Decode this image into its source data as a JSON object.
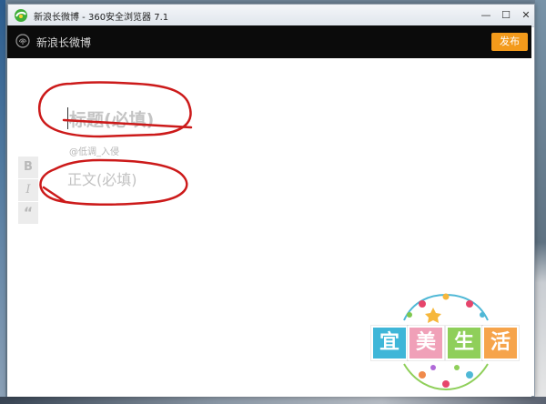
{
  "window": {
    "title": "新浪长微博 - 360安全浏览器 7.1",
    "controls": {
      "minimize": "—",
      "maximize": "☐",
      "close": "✕"
    }
  },
  "app": {
    "title": "新浪长微博",
    "publish_label": "发布"
  },
  "editor": {
    "title_placeholder": "标题(必填)",
    "author": "@低调_入侵",
    "body_placeholder": "正文(必填)"
  },
  "toolbar": {
    "bold_label": "B",
    "italic_label": "I",
    "quote_label": "“"
  },
  "sticker": {
    "chars": [
      "宜",
      "美",
      "生",
      "活"
    ]
  },
  "colors": {
    "header_bg": "#0b0b0b",
    "publish_bg": "#f39a1b",
    "annotation": "#cc1a1a"
  },
  "icons": {
    "browser_logo": "browser-logo-icon",
    "app_logo": "fingerprint-logo-icon"
  }
}
